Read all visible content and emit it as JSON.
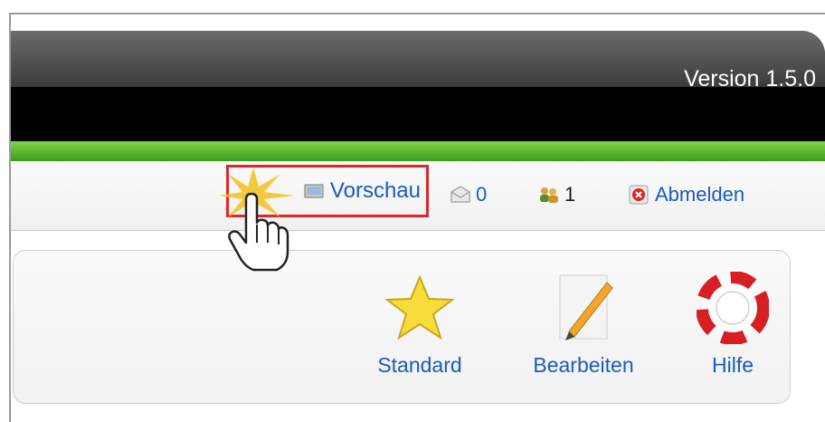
{
  "header": {
    "version_text": "Version 1.5.0"
  },
  "status_bar": {
    "preview_label": "Vorschau",
    "messages_count": "0",
    "users_count": "1",
    "logout_label": "Abmelden"
  },
  "toolbar": {
    "standard_label": "Standard",
    "edit_label": "Bearbeiten",
    "help_label": "Hilfe"
  },
  "icons": {
    "preview": "preview-icon",
    "messages": "envelope-icon",
    "users": "users-icon",
    "logout": "logout-icon",
    "standard": "star-icon",
    "edit": "pencil-icon",
    "help": "lifebuoy-icon",
    "cursor": "hand-cursor-icon"
  },
  "colors": {
    "link_blue": "#1a5bb8",
    "accent_green": "#57b52a",
    "highlight_red": "#e0262b"
  }
}
